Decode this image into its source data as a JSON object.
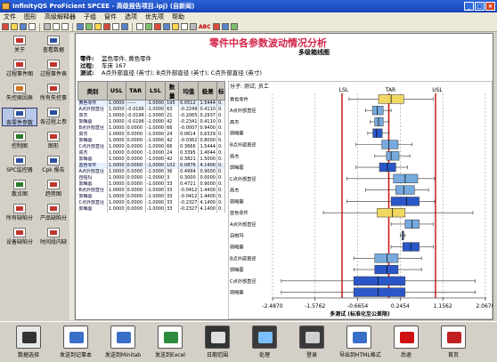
{
  "window": {
    "title": "InfinityQS ProFicient SPCEE - 高级报告项目.ipj) (自新闻)"
  },
  "menu": [
    "文件",
    "图形",
    "高级解释器",
    "子组",
    "窗件",
    "选项",
    "优先项",
    "帮助"
  ],
  "toolbar_text": "ABC",
  "left_panel": [
    {
      "label": "关于",
      "icon": "about-icon",
      "color": "#c0342c"
    },
    {
      "label": "查看数据",
      "icon": "data-view-icon",
      "color": "#2c4fa0"
    },
    {
      "label": "过程事件图",
      "icon": "process-event-icon",
      "color": "#c0342c"
    },
    {
      "label": "过程事件表",
      "icon": "process-table-icon",
      "color": "#c0342c"
    },
    {
      "label": "失控原因表",
      "icon": "out-of-control-icon",
      "color": "#cc7722"
    },
    {
      "label": "所有失控事",
      "icon": "all-events-icon",
      "color": "#c0342c"
    },
    {
      "label": "各零件参数",
      "icon": "part-param-icon",
      "color": "#2c4fa0"
    },
    {
      "label": "各过程上参",
      "icon": "process-param-icon",
      "color": "#2c4fa0"
    },
    {
      "label": "控制图",
      "icon": "control-chart-icon",
      "color": "#2c7a2c"
    },
    {
      "label": "图形",
      "icon": "graph-icon",
      "color": "#c0342c"
    },
    {
      "label": "SPC监控器",
      "icon": "spc-monitor-icon",
      "color": "#2c4fa0"
    },
    {
      "label": "Cpk 报告",
      "icon": "cpk-icon",
      "color": "#2c4fa0"
    },
    {
      "label": "散点图",
      "icon": "scatter-icon",
      "color": "#2c7a2c"
    },
    {
      "label": "趋势图",
      "icon": "trend-icon",
      "color": "#c0342c"
    },
    {
      "label": "所有缺陷分",
      "icon": "defect-icon",
      "color": "#c0342c"
    },
    {
      "label": "产品缺陷分",
      "icon": "product-defect-icon",
      "color": "#c0342c"
    },
    {
      "label": "设备缺陷分",
      "icon": "equipment-defect-icon",
      "color": "#c0342c"
    },
    {
      "label": "时间段内缺",
      "icon": "time-defect-icon",
      "color": "#c0342c"
    }
  ],
  "report": {
    "title": "零件中各参数波动情况分析",
    "subtitle": "多级箱线图",
    "part_label": "零件:",
    "part_value": "篮色零件, 黄色零件",
    "process_label": "过程:",
    "process_value": "车床 167",
    "test_label": "测试:",
    "test_value": "A点外部直径 (英寸); B点外部直径 (英寸); C点外部直径 (英寸)"
  },
  "table": {
    "columns": [
      "类别",
      "USL",
      "TAR",
      "LSL",
      "数量",
      "均值",
      "极差",
      "标"
    ],
    "rows": [
      {
        "name": "黄色零件",
        "usl": "1.0000",
        "tar": "------",
        "lsl": "-1.0000",
        "n": "195",
        "mean": "0.0512",
        "range": "1.5444",
        "sd": "0.",
        "group": true
      },
      {
        "name": "A点外部直径",
        "usl": "1.0000",
        "tar": "-0.0196",
        "lsl": "-1.0000",
        "n": "63",
        "mean": "-0.2249",
        "range": "0.4110",
        "sd": "0."
      },
      {
        "name": "高杰",
        "usl": "1.0000",
        "tar": "-0.0196",
        "lsl": "-1.0000",
        "n": "21",
        "mean": "-0.2065",
        "range": "0.2937",
        "sd": "0."
      },
      {
        "name": "郭晦蓉",
        "usl": "1.0000",
        "tar": "-0.0196",
        "lsl": "-1.0000",
        "n": "42",
        "mean": "-0.2341",
        "range": "0.4110",
        "sd": "0."
      },
      {
        "name": "B点外部直径",
        "usl": "1.0000",
        "tar": "0.0000",
        "lsl": "-1.0000",
        "n": "66",
        "mean": "-0.0007",
        "range": "0.9400",
        "sd": "0."
      },
      {
        "name": "高杰",
        "usl": "1.0000",
        "tar": "0.0000",
        "lsl": "-1.0000",
        "n": "24",
        "mean": "0.0614",
        "range": "0.6329",
        "sd": "0."
      },
      {
        "name": "郭晦蓉",
        "usl": "1.0000",
        "tar": "0.0000",
        "lsl": "-1.0000",
        "n": "42",
        "mean": "-0.0362",
        "range": "0.8000",
        "sd": "0."
      },
      {
        "name": "C点外部直径",
        "usl": "1.0000",
        "tar": "0.0000",
        "lsl": "-1.0000",
        "n": "66",
        "mean": "0.3666",
        "range": "1.5444",
        "sd": "0."
      },
      {
        "name": "高杰",
        "usl": "1.0000",
        "tar": "0.0000",
        "lsl": "-1.0000",
        "n": "24",
        "mean": "0.3395",
        "range": "1.4044",
        "sd": "0."
      },
      {
        "name": "郭晦蓉",
        "usl": "1.0000",
        "tar": "0.0000",
        "lsl": "-1.0000",
        "n": "42",
        "mean": "0.3821",
        "range": "1.5000",
        "sd": "0."
      },
      {
        "name": "蓝色零件",
        "usl": "1.0000",
        "tar": "0.0000",
        "lsl": "-1.0000",
        "n": "102",
        "mean": "0.0876",
        "range": "4.1400",
        "sd": "0.",
        "group": true
      },
      {
        "name": "A点外部直径",
        "usl": "1.0000",
        "tar": "0.0000",
        "lsl": "-1.0000",
        "n": "36",
        "mean": "0.4994",
        "range": "0.9000",
        "sd": "0."
      },
      {
        "name": "自帕玛",
        "usl": "1.0000",
        "tar": "0.0000",
        "lsl": "-1.0000",
        "n": "3",
        "mean": "0.3000",
        "range": "0.0000",
        "sd": "0."
      },
      {
        "name": "郭晦蓉",
        "usl": "1.0000",
        "tar": "0.0000",
        "lsl": "-1.0000",
        "n": "33",
        "mean": "0.4721",
        "range": "0.9000",
        "sd": "0."
      },
      {
        "name": "B点外部直径",
        "usl": "1.0000",
        "tar": "0.0000",
        "lsl": "-1.0000",
        "n": "33",
        "mean": "-0.0412",
        "range": "1.4400",
        "sd": "0."
      },
      {
        "name": "郭晦蓉",
        "usl": "1.0000",
        "tar": "0.0000",
        "lsl": "-1.0000",
        "n": "33",
        "mean": "-0.0412",
        "range": "1.4400",
        "sd": "0."
      },
      {
        "name": "C点外部直径",
        "usl": "1.0000",
        "tar": "0.0000",
        "lsl": "-1.0000",
        "n": "33",
        "mean": "-0.2327",
        "range": "4.1400",
        "sd": "0."
      },
      {
        "name": "郭晦蓉",
        "usl": "1.0000",
        "tar": "0.0000",
        "lsl": "-1.0000",
        "n": "33",
        "mean": "-0.2327",
        "range": "4.1400",
        "sd": "0."
      }
    ]
  },
  "chart_data": {
    "type": "boxplot",
    "title": "分子: 测试; 员工",
    "xlabel": "多测试 (标准化至公差限)",
    "xlim": [
      -2.487,
      2.087
    ],
    "xticks": [
      "-2.4870",
      "-1.5762",
      "-0.6654",
      "0.2454",
      "1.1562",
      "2.0670"
    ],
    "reference_lines": {
      "LSL": -1.0,
      "TAR": 0.0,
      "USL": 1.0
    },
    "categories": [
      "黄色零件",
      "A点外部直径",
      "高杰",
      "郭晦蓉",
      "B点外部直径",
      "高杰",
      "郭晦蓉",
      "C点外部直径",
      "高杰",
      "郭晦蓉",
      "蓝色零件",
      "A点外部直径",
      "自帕玛",
      "郭晦蓉",
      "B点外部直径",
      "郭晦蓉",
      "C点外部直径",
      "郭晦蓉"
    ],
    "boxes": [
      {
        "min": -0.85,
        "q1": -0.22,
        "median": 0.05,
        "q3": 0.32,
        "max": 0.95,
        "color": "#f0d860"
      },
      {
        "min": -0.5,
        "q1": -0.35,
        "median": -0.25,
        "q3": -0.12,
        "max": 0.05,
        "color": "#77aadd"
      },
      {
        "min": -0.4,
        "q1": -0.3,
        "median": -0.22,
        "q3": -0.12,
        "max": 0.0,
        "color": "#77aadd"
      },
      {
        "min": -0.45,
        "q1": -0.34,
        "median": -0.26,
        "q3": -0.14,
        "max": 0.0,
        "color": "#2a57c8"
      },
      {
        "min": -0.7,
        "q1": -0.15,
        "median": 0.0,
        "q3": 0.2,
        "max": 0.5,
        "color": "#77aadd"
      },
      {
        "min": -0.3,
        "q1": -0.05,
        "median": 0.05,
        "q3": 0.22,
        "max": 0.45,
        "color": "#77aadd"
      },
      {
        "min": -0.7,
        "q1": -0.2,
        "median": -0.03,
        "q3": 0.15,
        "max": 0.4,
        "color": "#2a57c8"
      },
      {
        "min": -0.9,
        "q1": 0.1,
        "median": 0.35,
        "q3": 0.62,
        "max": 0.98,
        "color": "#77aadd"
      },
      {
        "min": -0.5,
        "q1": 0.15,
        "median": 0.32,
        "q3": 0.55,
        "max": 0.85,
        "color": "#77aadd"
      },
      {
        "min": -0.9,
        "q1": 0.05,
        "median": 0.38,
        "q3": 0.65,
        "max": 0.98,
        "color": "#2a57c8"
      },
      {
        "min": -1.4,
        "q1": -0.25,
        "median": 0.08,
        "q3": 0.35,
        "max": 1.8,
        "color": "#f0d860"
      },
      {
        "min": 0.05,
        "q1": 0.35,
        "median": 0.5,
        "q3": 0.65,
        "max": 0.95,
        "color": "#77aadd"
      },
      {
        "min": 0.25,
        "q1": 0.28,
        "median": 0.3,
        "q3": 0.32,
        "max": 0.35,
        "color": "#77aadd"
      },
      {
        "min": 0.05,
        "q1": 0.3,
        "median": 0.47,
        "q3": 0.65,
        "max": 0.95,
        "color": "#2a57c8"
      },
      {
        "min": -0.75,
        "q1": -0.3,
        "median": -0.04,
        "q3": 0.2,
        "max": 0.7,
        "color": "#77aadd"
      },
      {
        "min": -0.75,
        "q1": -0.3,
        "median": -0.04,
        "q3": 0.2,
        "max": 0.7,
        "color": "#2a57c8"
      },
      {
        "min": -2.3,
        "q1": -0.75,
        "median": -0.23,
        "q3": 0.35,
        "max": 1.85,
        "color": "#2a57c8"
      },
      {
        "min": -2.3,
        "q1": -0.75,
        "median": -0.23,
        "q3": 0.35,
        "max": 1.85,
        "color": "#2a57c8"
      }
    ]
  },
  "bottom_buttons": [
    {
      "label": "数据选择",
      "icon": "binoculars-icon",
      "bg": "#e8e8e8",
      "fg": "#333333"
    },
    {
      "label": "发送到记事本",
      "icon": "notepad-icon",
      "bg": "#ffffff",
      "fg": "#3a6fc8"
    },
    {
      "label": "发送到Minitab",
      "icon": "minitab-icon",
      "bg": "#ffffff",
      "fg": "#3a6fc8"
    },
    {
      "label": "发送到Excel",
      "icon": "excel-icon",
      "bg": "#ffffff",
      "fg": "#2c8a3c"
    },
    {
      "label": "日期范围",
      "icon": "calendar-icon",
      "bg": "#333333",
      "fg": "#e0e0e0"
    },
    {
      "label": "处理",
      "icon": "process-icon",
      "bg": "#3a3a3a",
      "fg": "#7ac0ff"
    },
    {
      "label": "登录",
      "icon": "login-icon",
      "bg": "#3a3a3a",
      "fg": "#d0d0d0"
    },
    {
      "label": "导出到HTML格式",
      "icon": "html-export-icon",
      "bg": "#ffffff",
      "fg": "#3a6fc8"
    },
    {
      "label": "后退",
      "icon": "back-arrow-icon",
      "bg": "#ffffff",
      "fg": "#d01010"
    },
    {
      "label": "首页",
      "icon": "home-icon",
      "bg": "#ffffff",
      "fg": "#c02020"
    }
  ]
}
